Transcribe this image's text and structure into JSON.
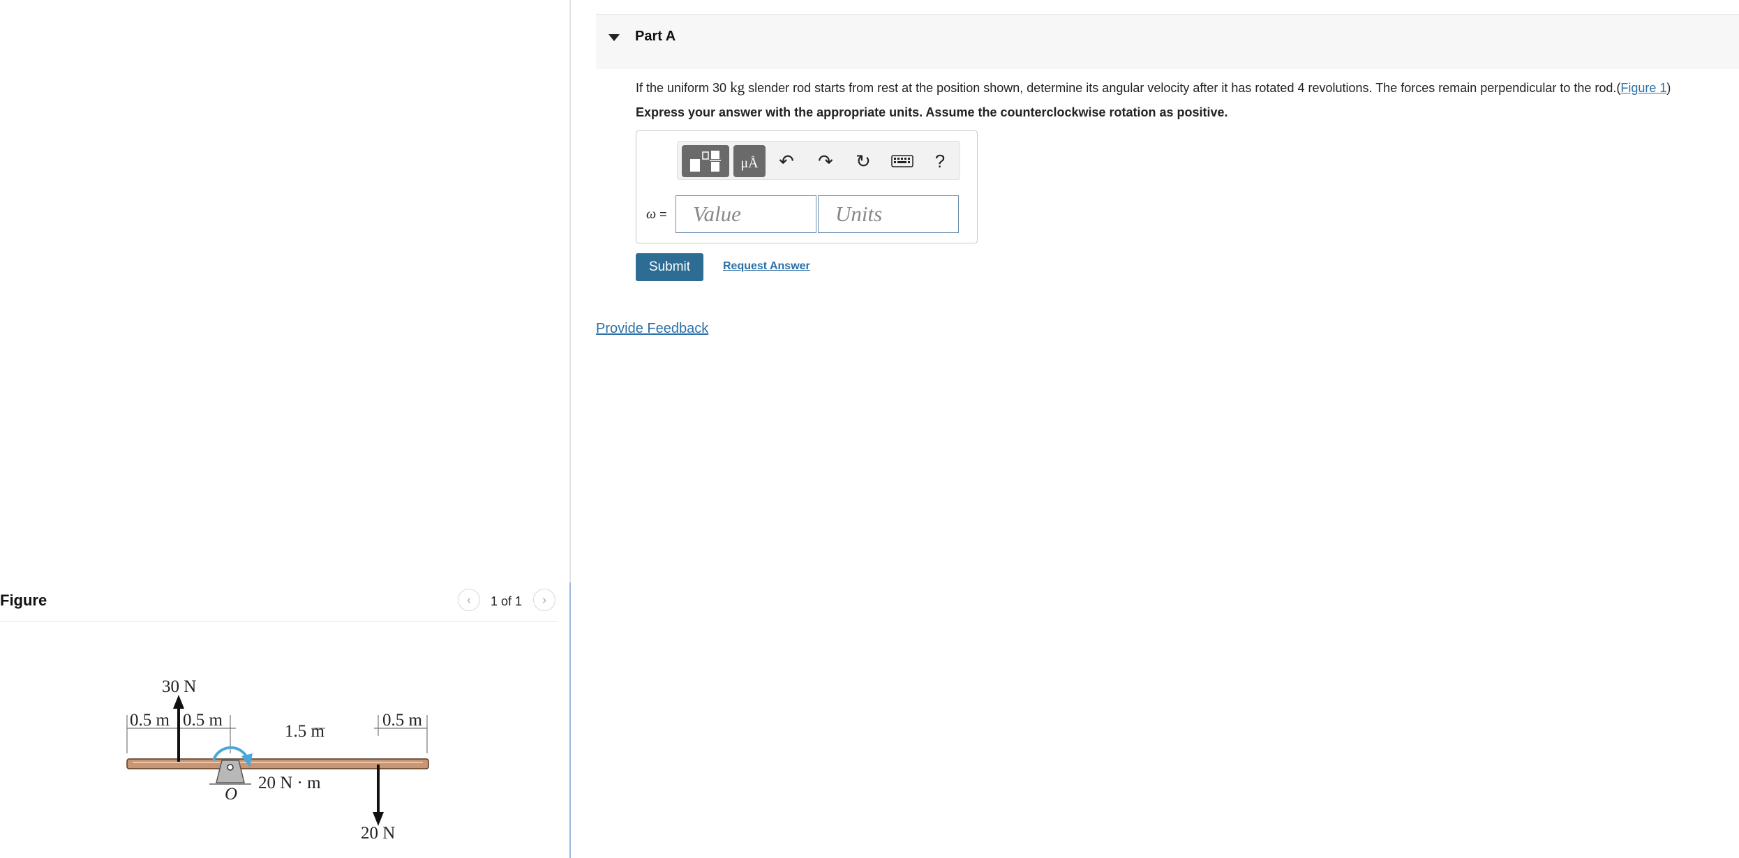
{
  "figure_panel": {
    "title": "Figure",
    "page_indicator": "1 of 1",
    "prev_icon": "chevron-left-icon",
    "next_icon": "chevron-right-icon",
    "diagram": {
      "force_up_label": "30 N",
      "force_down_label": "20 N",
      "moment_label": "20 N · m",
      "pivot_label": "O",
      "dim_1": "0.5 m",
      "dim_2": "0.5 m",
      "dim_3": "1.5 m",
      "dim_4": "0.5 m"
    }
  },
  "part": {
    "title": "Part A",
    "question_pre": "If the uniform 30 ",
    "question_unit": "kg",
    "question_post": " slender rod starts from rest at the position shown, determine its angular velocity after it has rotated 4 revolutions. The forces remain perpendicular to the rod.(",
    "figure_link": "Figure 1",
    "question_close": ")",
    "instructions": "Express your answer with the appropriate units. Assume the counterclockwise rotation as positive.",
    "answer": {
      "label_symbol": "ω",
      "label_eq": " =",
      "value_placeholder": "Value",
      "units_placeholder": "Units",
      "units_button": "μÅ",
      "help": "?"
    },
    "submit_label": "Submit",
    "request_label": "Request Answer"
  },
  "feedback_label": "Provide Feedback",
  "colors": {
    "link": "#2a6fa8",
    "submit": "#2e6d93",
    "rod": "#c99572",
    "moment_arrow": "#4aa8d8"
  }
}
